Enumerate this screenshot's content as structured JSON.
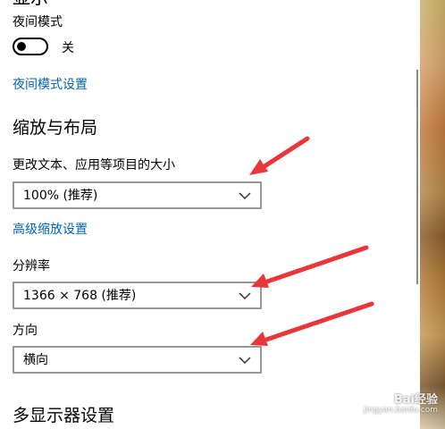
{
  "section_top": {
    "title_cut": "显示"
  },
  "night_mode": {
    "label": "夜间模式",
    "toggle_state_text": "关",
    "toggle_on": false,
    "settings_link": "夜间模式设置"
  },
  "scale_layout": {
    "heading": "缩放与布局",
    "text_size_label": "更改文本、应用等项目的大小",
    "text_size_value": "100% (推荐)",
    "advanced_link": "高级缩放设置",
    "resolution_label": "分辨率",
    "resolution_value": "1366 × 768 (推荐)",
    "orientation_label": "方向",
    "orientation_value": "横向"
  },
  "multi_display": {
    "heading": "多显示器设置"
  },
  "icons": {
    "dropdown_chevron": "chevron-down-icon",
    "annotation_arrow": "red-arrow-icon"
  },
  "watermark": {
    "line1": "Bai经验",
    "line2": "jingyan.baidu.com"
  },
  "colors": {
    "link": "#0063b1",
    "arrow": "#e8363a",
    "dropdown_border": "#999999"
  }
}
